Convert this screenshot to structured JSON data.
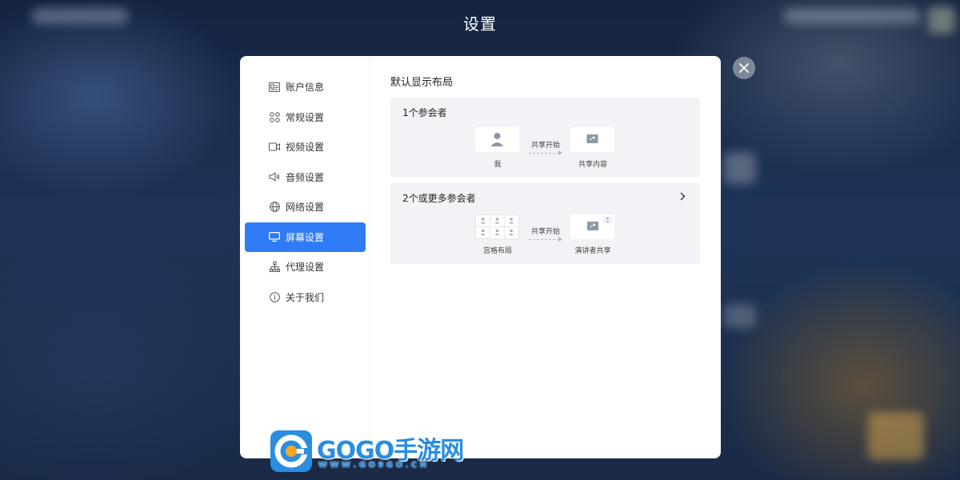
{
  "window": {
    "title": "设置"
  },
  "sidebar": {
    "items": [
      {
        "label": "账户信息",
        "icon": "id-card-icon"
      },
      {
        "label": "常规设置",
        "icon": "grid-icon"
      },
      {
        "label": "视频设置",
        "icon": "video-icon"
      },
      {
        "label": "音频设置",
        "icon": "speaker-icon"
      },
      {
        "label": "网络设置",
        "icon": "globe-icon"
      },
      {
        "label": "屏幕设置",
        "icon": "monitor-icon",
        "active": true
      },
      {
        "label": "代理设置",
        "icon": "network-icon"
      },
      {
        "label": "关于我们",
        "icon": "info-icon"
      }
    ]
  },
  "main": {
    "section_title": "默认显示布局",
    "cards": [
      {
        "title": "1个参会者",
        "left_caption": "我",
        "arrow_label": "共享开始",
        "right_caption": "共享内容"
      },
      {
        "title": "2个或更多参会者",
        "left_caption": "宫格布局",
        "arrow_label": "共享开始",
        "right_caption": "演讲者共享"
      }
    ]
  },
  "watermark": {
    "brand": "GOGO手游网",
    "url": "W W W . G O 9 G O . C N"
  },
  "colors": {
    "accent": "#2f7bf5",
    "card_bg": "#f2f3f6",
    "watermark_blue": "#2a8de0"
  }
}
